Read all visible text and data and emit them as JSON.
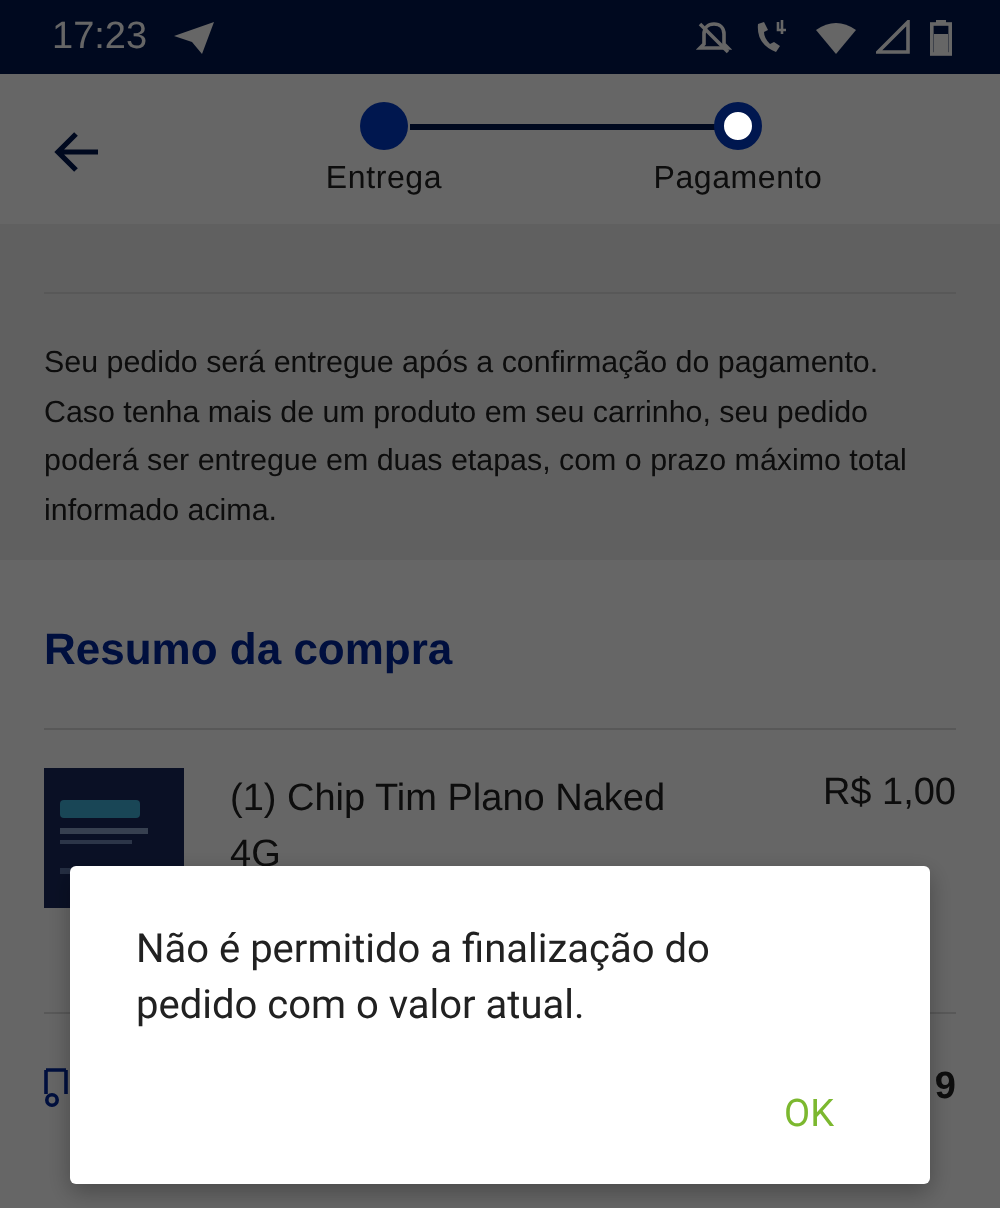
{
  "status_bar": {
    "time": "17:23"
  },
  "header": {
    "steps": [
      {
        "label": "Entrega",
        "done": true
      },
      {
        "label": "Pagamento",
        "done": false
      }
    ]
  },
  "delivery_note": "Seu pedido será entregue após a confirmação do pagamento. Caso tenha mais de um produto em seu carrinho, seu pedido poderá ser entregue em duas etapas, com o prazo máximo total informado acima.",
  "summary": {
    "title": "Resumo da compra",
    "items": [
      {
        "name": "(1) Chip Tim Plano Naked 4G",
        "price": "R$ 1,00"
      }
    ],
    "shipping_price": "9"
  },
  "dialog": {
    "message": "Não é permitido a finalização do pedido com o valor atual.",
    "buttons": [
      "OK"
    ]
  }
}
